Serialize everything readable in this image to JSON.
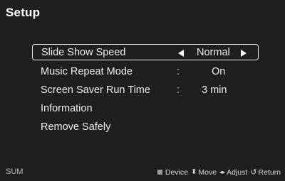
{
  "screen": {
    "title": "Setup",
    "menu": {
      "items": [
        {
          "label": "Slide Show Speed",
          "value": "Normal"
        },
        {
          "label": "Music Repeat Mode",
          "value": "On"
        },
        {
          "label": "Screen Saver Run Time",
          "value": "3 min"
        },
        {
          "label": "Information"
        },
        {
          "label": "Remove Safely"
        }
      ],
      "separator": ":"
    },
    "footer": {
      "left": "SUM",
      "hints": [
        {
          "icon": "square-icon",
          "label": "Device"
        },
        {
          "icon": "updown-arrows-icon",
          "label": "Move"
        },
        {
          "icon": "leftright-arrows-icon",
          "label": "Adjust"
        },
        {
          "icon": "return-icon",
          "label": "Return"
        }
      ]
    }
  }
}
